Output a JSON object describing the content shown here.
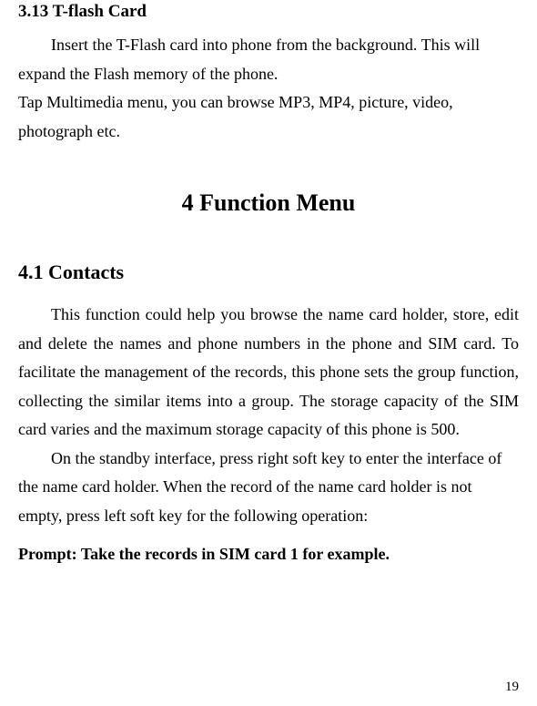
{
  "section_3_13": {
    "heading": "3.13  T-flash Card",
    "para1": "Insert the T-Flash card into phone from the background. This will expand the Flash memory of the phone.",
    "para2": "Tap Multimedia menu, you can browse MP3, MP4, picture, video, photograph etc."
  },
  "chapter_4": {
    "heading": "4    Function Menu"
  },
  "section_4_1": {
    "heading": "4.1    Contacts",
    "para1": "This function could help you browse the name card holder, store, edit and delete the names and phone numbers in the phone and SIM card. To facilitate the management of the records, this phone sets the group function, collecting the similar items into a group. The storage capacity of the SIM card varies and the maximum storage capacity of this phone is 500.",
    "para2": "On the standby interface, press right soft key to enter the interface of the name card holder. When the record of the name card holder is not empty, press left soft key for the following operation:",
    "prompt": "Prompt: Take the records in SIM card 1 for example."
  },
  "page_number": "19"
}
